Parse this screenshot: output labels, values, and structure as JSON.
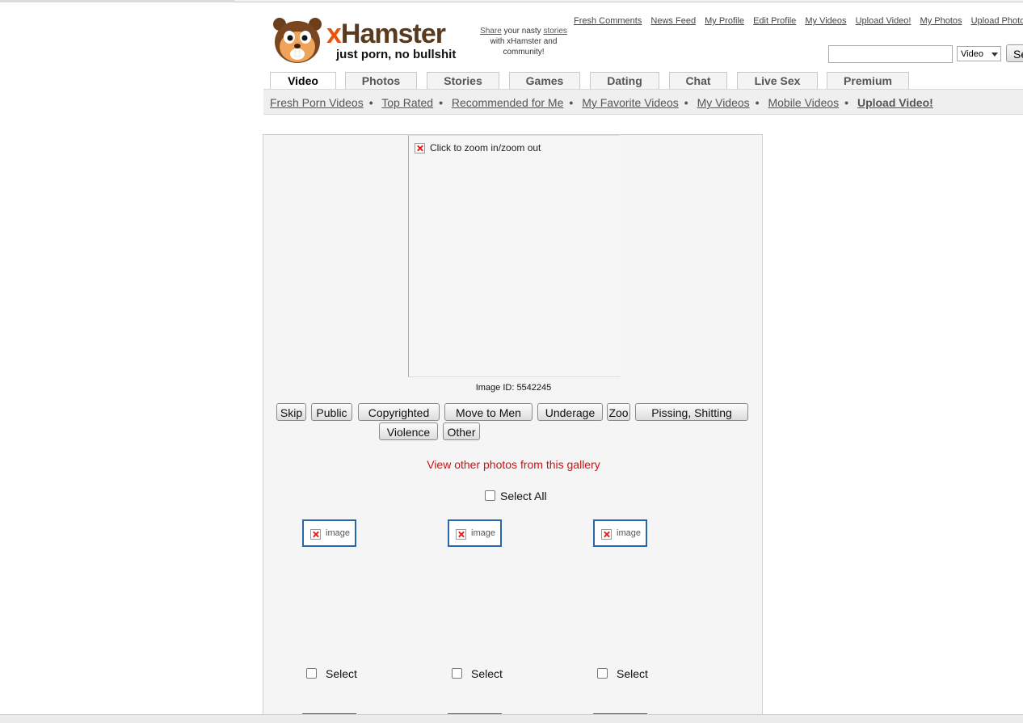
{
  "header": {
    "logo_x": "x",
    "logo_hamster": "Hamster",
    "tagline": "just porn, no bullshit",
    "share_link": "Share",
    "share_text1": " your nasty ",
    "share_link2": "stories",
    "share_text2": "with xHamster and community!",
    "top_links": [
      "Fresh Comments",
      "News Feed",
      "My Profile",
      "Edit Profile",
      "My Videos",
      "Upload Video!",
      "My Photos",
      "Upload Photos!"
    ],
    "search_select": "Video",
    "search_button": "Se"
  },
  "tabs": [
    "Video",
    "Photos",
    "Stories",
    "Games",
    "Dating",
    "Chat",
    "Live Sex",
    "Premium"
  ],
  "subnav": [
    "Fresh Porn Videos",
    "Top Rated",
    "Recommended for Me",
    "My Favorite Videos",
    "My Videos",
    "Mobile Videos",
    "Upload Video!"
  ],
  "viewer": {
    "caption": "Click to zoom in/zoom out",
    "image_id": "Image ID: 5542245"
  },
  "moderation_buttons": [
    "Skip",
    "Public",
    "Copyrighted",
    "Move to Men",
    "Underage",
    "Zoo",
    "Pissing, Shitting",
    "Violence",
    "Other"
  ],
  "gallery": {
    "link": "View other photos from this gallery",
    "select_all": "Select All",
    "thumb_label": "image",
    "select_label": "Select"
  }
}
